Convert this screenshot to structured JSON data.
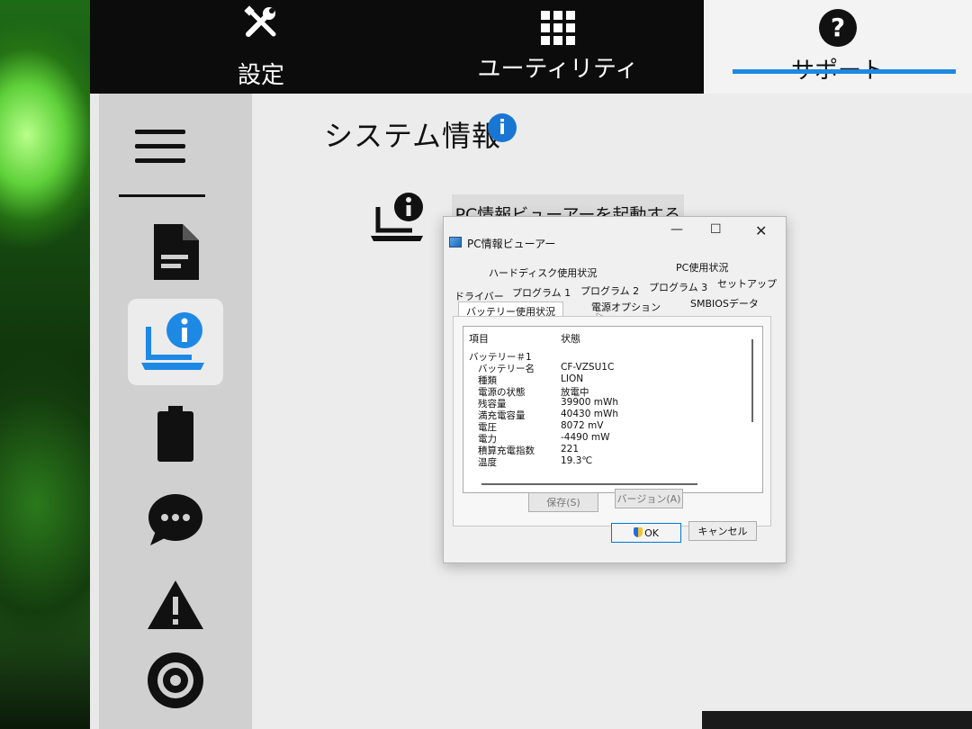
{
  "top_tabs": {
    "settings": "設定",
    "utility": "ユーティリティ",
    "support": "サポート"
  },
  "page": {
    "title": "システム情報",
    "launch_button": "PC情報ビューアーを起動する"
  },
  "dialog": {
    "title": "PC情報ビューアー",
    "tabs_row1": [
      "ハードディスク使用状況",
      "PC使用状況"
    ],
    "tabs_row2": [
      "ドライバー",
      "プログラム 1",
      "プログラム 2",
      "プログラム 3",
      "セットアップ"
    ],
    "tabs_row3": [
      "バッテリー使用状況",
      "電源オプション",
      "SMBIOSデータ"
    ],
    "list": {
      "col_item": "項目",
      "col_status": "状態",
      "rows": [
        {
          "k": "バッテリー＃1",
          "v": ""
        },
        {
          "k": "バッテリー名",
          "v": "CF-VZSU1C"
        },
        {
          "k": "種類",
          "v": "LION"
        },
        {
          "k": "電源の状態",
          "v": "放電中"
        },
        {
          "k": "残容量",
          "v": "39900 mWh"
        },
        {
          "k": "満充電容量",
          "v": "40430 mWh"
        },
        {
          "k": "電圧",
          "v": "8072 mV"
        },
        {
          "k": "電力",
          "v": "-4490 mW"
        },
        {
          "k": "積算充電指数",
          "v": "221"
        },
        {
          "k": "温度",
          "v": "19.3℃"
        }
      ]
    },
    "buttons": {
      "save": "保存(S)",
      "version": "バージョン(A)",
      "ok": "OK",
      "cancel": "キャンセル"
    }
  },
  "colors": {
    "accent": "#1e88e5",
    "topbar": "#0c0c0c",
    "info_badge": "#1976d2"
  },
  "icons": {
    "settings": "tools-icon",
    "utility": "grid-icon",
    "support": "question-icon",
    "sidebar": [
      "menu-icon",
      "document-icon",
      "laptop-info-icon",
      "battery-icon",
      "chat-icon",
      "warning-icon",
      "disc-icon"
    ]
  }
}
